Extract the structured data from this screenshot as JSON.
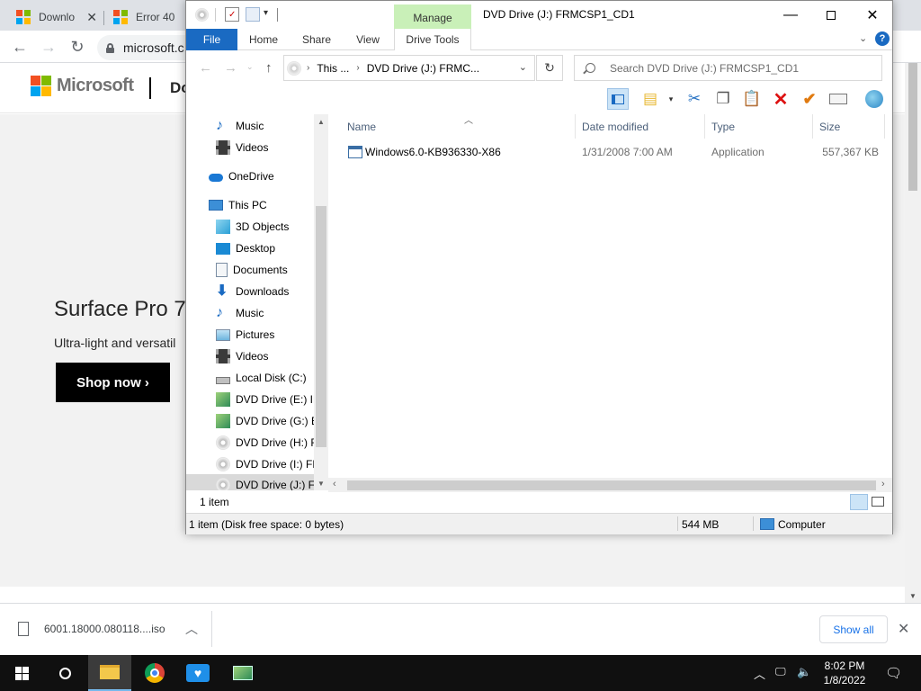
{
  "browser": {
    "tabs": [
      {
        "title": "Downlo"
      },
      {
        "title": "Error 40"
      }
    ],
    "url": "microsoft.c",
    "brand": "Microsoft",
    "header_partial": "Do",
    "hero": {
      "title": "Surface Pro 7",
      "subtitle": "Ultra-light and versatil",
      "cta": "Shop now"
    },
    "downloads": {
      "file": "6001.18000.080118....iso",
      "show_all": "Show all"
    },
    "colors": {
      "ms_red": "#f25022",
      "ms_green": "#7fba00",
      "ms_blue": "#00a4ef",
      "ms_yellow": "#ffb900"
    }
  },
  "explorer": {
    "window_title": "DVD Drive (J:) FRMCSP1_CD1",
    "contextual_group": "Manage",
    "ribbon_tabs": {
      "file": "File",
      "home": "Home",
      "share": "Share",
      "view": "View",
      "drive_tools": "Drive Tools"
    },
    "address": {
      "crumb1": "This ...",
      "crumb2": "DVD Drive (J:) FRMC..."
    },
    "search_placeholder": "Search DVD Drive (J:) FRMCSP1_CD1",
    "nav_items": [
      {
        "label": "Music",
        "icon": "music-icon"
      },
      {
        "label": "Videos",
        "icon": "videos-icon"
      },
      {
        "label": "OneDrive",
        "icon": "cloud-icon"
      },
      {
        "label": "This PC",
        "icon": "pc-icon"
      },
      {
        "label": "3D Objects",
        "icon": "cube-icon"
      },
      {
        "label": "Desktop",
        "icon": "desktop-icon"
      },
      {
        "label": "Documents",
        "icon": "documents-icon"
      },
      {
        "label": "Downloads",
        "icon": "downloads-icon"
      },
      {
        "label": "Music",
        "icon": "music-icon"
      },
      {
        "label": "Pictures",
        "icon": "pictures-icon"
      },
      {
        "label": "Videos",
        "icon": "videos-icon"
      },
      {
        "label": "Local Disk (C:)",
        "icon": "disk-icon"
      },
      {
        "label": "DVD Drive (E:) IR",
        "icon": "dvd-setup-icon"
      },
      {
        "label": "DVD Drive (G:) ES",
        "icon": "dvd-setup-icon"
      },
      {
        "label": "DVD Drive (H:) F",
        "icon": "disc-icon"
      },
      {
        "label": "DVD Drive (I:) FR",
        "icon": "disc-icon"
      },
      {
        "label": "DVD Drive (J:) FR",
        "icon": "disc-icon"
      }
    ],
    "columns": {
      "name": "Name",
      "date": "Date modified",
      "type": "Type",
      "size": "Size"
    },
    "files": [
      {
        "name": "Windows6.0-KB936330-X86",
        "date": "1/31/2008 7:00 AM",
        "type": "Application",
        "size": "557,367 KB"
      }
    ],
    "status": {
      "count": "1 item"
    },
    "details": {
      "selection": "1 item (Disk free space: 0 bytes)",
      "size": "544 MB",
      "location": "Computer"
    }
  },
  "taskbar": {
    "time": "8:02 PM",
    "date": "1/8/2022"
  }
}
